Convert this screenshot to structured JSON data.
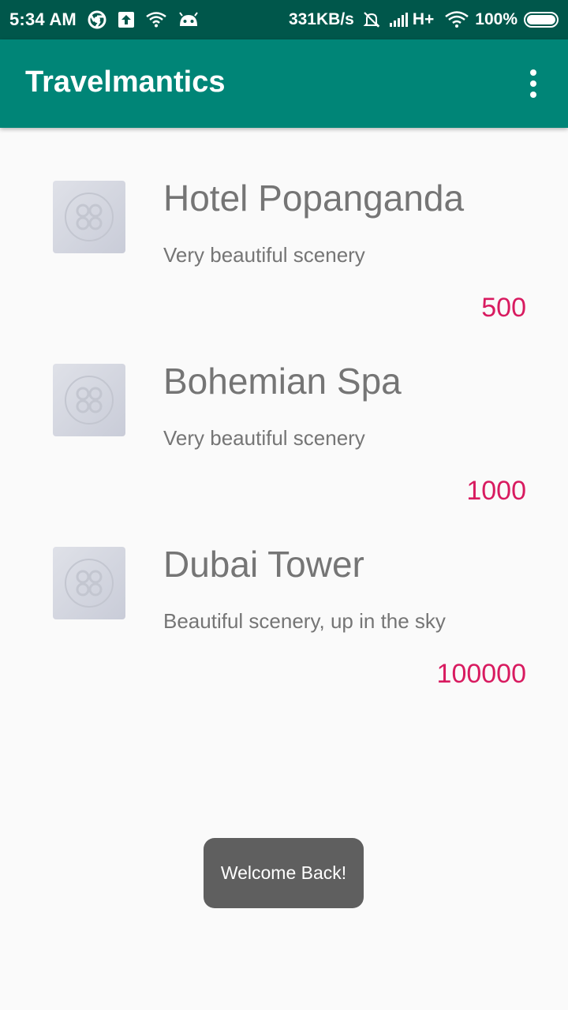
{
  "status_bar": {
    "time": "5:34 AM",
    "speed": "331KB/s",
    "network": "H+",
    "battery_percent": "100%",
    "icons_left": [
      "chrome-icon",
      "upload-icon",
      "wifi-icon",
      "android-icon"
    ],
    "icons_right": [
      "bell-off-icon",
      "signal-icon",
      "wifi-icon",
      "battery-icon"
    ]
  },
  "app_bar": {
    "title": "Travelmantics",
    "color": "#008577"
  },
  "deals": [
    {
      "title": "Hotel Popanganda",
      "description": "Very beautiful scenery",
      "price": "500"
    },
    {
      "title": "Bohemian Spa",
      "description": "Very beautiful scenery",
      "price": "1000"
    },
    {
      "title": "Dubai Tower",
      "description": "Beautiful scenery, up in the sky",
      "price": "100000"
    }
  ],
  "toast": {
    "message": "Welcome Back!"
  },
  "colors": {
    "accent": "#d81b60",
    "status_bar": "#00574b",
    "text": "#757575"
  }
}
